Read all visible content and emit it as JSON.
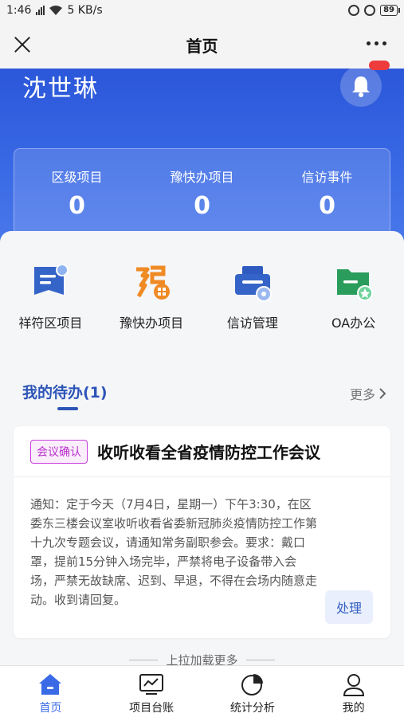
{
  "status_bar": {
    "time": "1:46",
    "network_speed": "5 KB/s",
    "battery": "89"
  },
  "nav": {
    "title": "首页"
  },
  "hero": {
    "user_name": "沈世琳",
    "stats": [
      {
        "label": "区级项目",
        "value": "0"
      },
      {
        "label": "豫快办项目",
        "value": "0"
      },
      {
        "label": "信访事件",
        "value": "0"
      }
    ]
  },
  "quick_links": [
    {
      "label": "祥符区项目",
      "icon": "document-badge-icon"
    },
    {
      "label": "豫快办项目",
      "icon": "yu-logo-icon"
    },
    {
      "label": "信访管理",
      "icon": "printer-gear-icon"
    },
    {
      "label": "OA办公",
      "icon": "folder-star-icon"
    }
  ],
  "todo": {
    "title": "我的待办(1)",
    "more_label": "更多",
    "item": {
      "tag": "会议确认",
      "title": "收听收看全省疫情防控工作会议",
      "body": "通知：定于今天（7月4日，星期一）下午3:30，在区委东三楼会议室收听收看省委新冠肺炎疫情防控工作第十九次专题会议，请通知常务副职参会。要求：戴口罩，提前15分钟入场完毕，严禁将电子设备带入会场，严禁无故缺席、迟到、早退，不得在会场内随意走动。收到请回复。",
      "action_label": "处理"
    },
    "pull_more": "上拉加载更多"
  },
  "tabs": [
    {
      "label": "首页",
      "icon": "home-icon",
      "active": true
    },
    {
      "label": "项目台账",
      "icon": "monitor-chart-icon",
      "active": false
    },
    {
      "label": "统计分析",
      "icon": "pie-chart-icon",
      "active": false
    },
    {
      "label": "我的",
      "icon": "user-icon",
      "active": false
    }
  ],
  "colors": {
    "primary": "#3a6ae6",
    "hero_dark": "#2b57d9",
    "tag": "#c83ddc",
    "badge": "#ee3b3b"
  }
}
